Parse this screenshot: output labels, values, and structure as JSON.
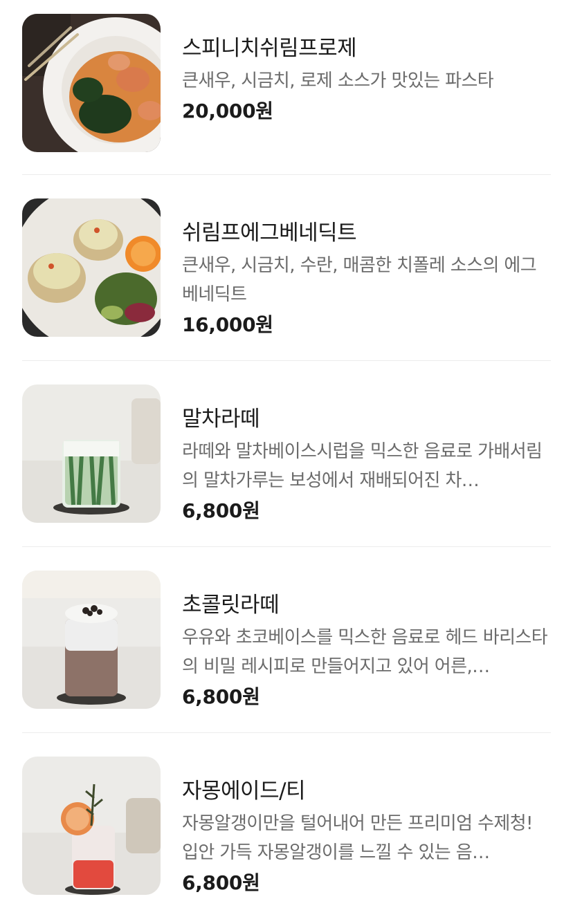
{
  "menu": {
    "items": [
      {
        "name": "스피니치쉬림프로제",
        "description": "큰새우, 시금치, 로제 소스가 맛있는 파스타",
        "price": "20,000원",
        "image": "shrimp-rose-pasta-photo"
      },
      {
        "name": "쉬림프에그베네딕트",
        "description": "큰새우, 시금치, 수란, 매콤한 치폴레 소스의 에그베네딕트",
        "price": "16,000원",
        "image": "shrimp-eggs-benedict-photo"
      },
      {
        "name": "말차라떼",
        "description": "라떼와 말차베이스시럽을 믹스한 음료로 가배서림의 말차가루는 보성에서 재배되어진 차…",
        "price": "6,800원",
        "image": "matcha-latte-photo"
      },
      {
        "name": "초콜릿라떼",
        "description": "우유와 초코베이스를 믹스한 음료로 헤드 바리스타의 비밀 레시피로 만들어지고 있어 어른,…",
        "price": "6,800원",
        "image": "chocolate-latte-photo"
      },
      {
        "name": "자몽에이드/티",
        "description": "자몽알갱이만을 털어내어 만든 프리미엄 수제청! 입안 가득 자몽알갱이를 느낄 수 있는 음…",
        "price": "6,800원",
        "image": "grapefruit-ade-photo"
      }
    ]
  }
}
